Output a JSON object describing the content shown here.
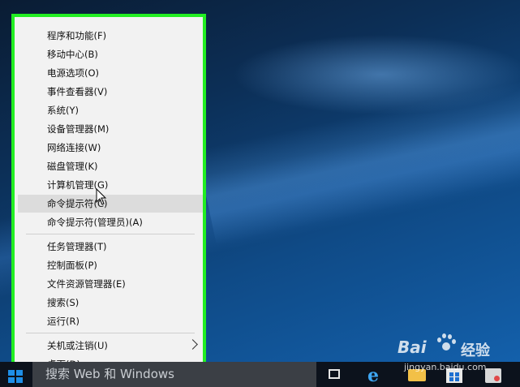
{
  "menu": {
    "items": [
      {
        "label": "程序和功能(F)"
      },
      {
        "label": "移动中心(B)"
      },
      {
        "label": "电源选项(O)"
      },
      {
        "label": "事件查看器(V)"
      },
      {
        "label": "系统(Y)"
      },
      {
        "label": "设备管理器(M)"
      },
      {
        "label": "网络连接(W)"
      },
      {
        "label": "磁盘管理(K)"
      },
      {
        "label": "计算机管理(G)"
      },
      {
        "label": "命令提示符(C)"
      },
      {
        "label": "命令提示符(管理员)(A)"
      },
      {
        "label": "任务管理器(T)"
      },
      {
        "label": "控制面板(P)"
      },
      {
        "label": "文件资源管理器(E)"
      },
      {
        "label": "搜索(S)"
      },
      {
        "label": "运行(R)"
      },
      {
        "label": "关机或注销(U)"
      },
      {
        "label": "桌面(D)"
      }
    ],
    "highlighted_item": "命令提示符(C)"
  },
  "taskbar": {
    "search_placeholder": "搜索 Web 和 Windows",
    "icons": [
      "windows-start-icon",
      "task-view-icon",
      "edge-browser-icon",
      "file-explorer-icon",
      "store-icon",
      "app-icon"
    ]
  },
  "watermark": {
    "brand": "Bai",
    "brand_cn": "经验",
    "url": "jingyan.baidu.com"
  },
  "colors": {
    "highlight_frame": "#22ee22",
    "menu_bg": "#f2f2f2",
    "hover_bg": "#dcdcdc",
    "taskbar_bg": "#0c121c",
    "accent_blue": "#1e8fe8"
  }
}
